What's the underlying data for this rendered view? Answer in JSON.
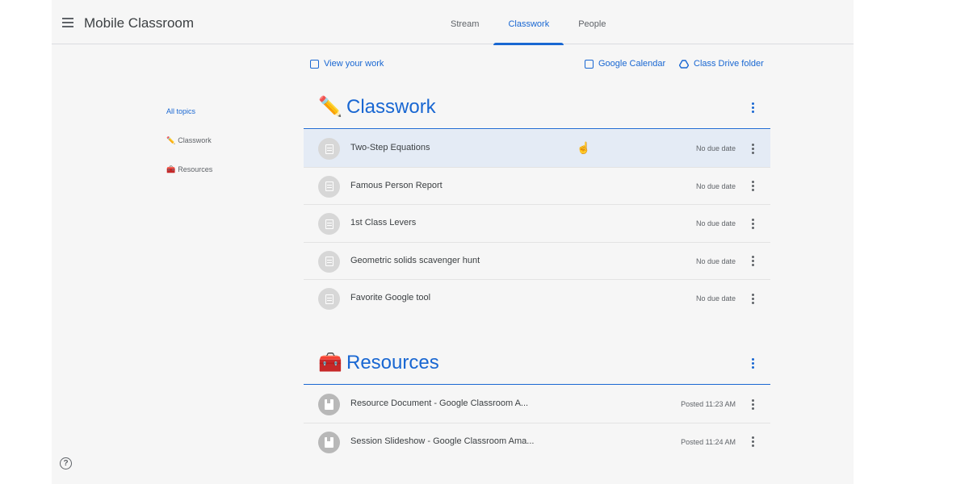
{
  "header": {
    "title": "Mobile Classroom",
    "tabs": [
      {
        "label": "Stream"
      },
      {
        "label": "Classwork"
      },
      {
        "label": "People"
      }
    ]
  },
  "toolbar": {
    "view_work": "View your work",
    "calendar": "Google Calendar",
    "drive": "Class Drive folder"
  },
  "sidebar": {
    "items": [
      {
        "label": "All topics",
        "emoji": ""
      },
      {
        "label": "Classwork",
        "emoji": "✏️"
      },
      {
        "label": "Resources",
        "emoji": "🧰"
      }
    ]
  },
  "sections": [
    {
      "emoji": "✏️",
      "title": "Classwork",
      "items": [
        {
          "title": "Two-Step Equations",
          "meta": "No due date"
        },
        {
          "title": "Famous Person Report",
          "meta": "No due date"
        },
        {
          "title": "1st Class Levers",
          "meta": "No due date"
        },
        {
          "title": "Geometric solids scavenger hunt",
          "meta": "No due date"
        },
        {
          "title": "Favorite Google tool",
          "meta": "No due date"
        }
      ]
    },
    {
      "emoji": "🧰",
      "title": "Resources",
      "items": [
        {
          "title": "Resource Document - Google Classroom A...",
          "meta": "Posted 11:23 AM"
        },
        {
          "title": "Session Slideshow - Google Classroom Ama...",
          "meta": "Posted 11:24 AM"
        }
      ]
    }
  ],
  "help": {
    "glyph": "?"
  },
  "colors": {
    "accent": "#1967d2",
    "background": "#f6f6f6",
    "hover_row": "#e4ebf5"
  }
}
